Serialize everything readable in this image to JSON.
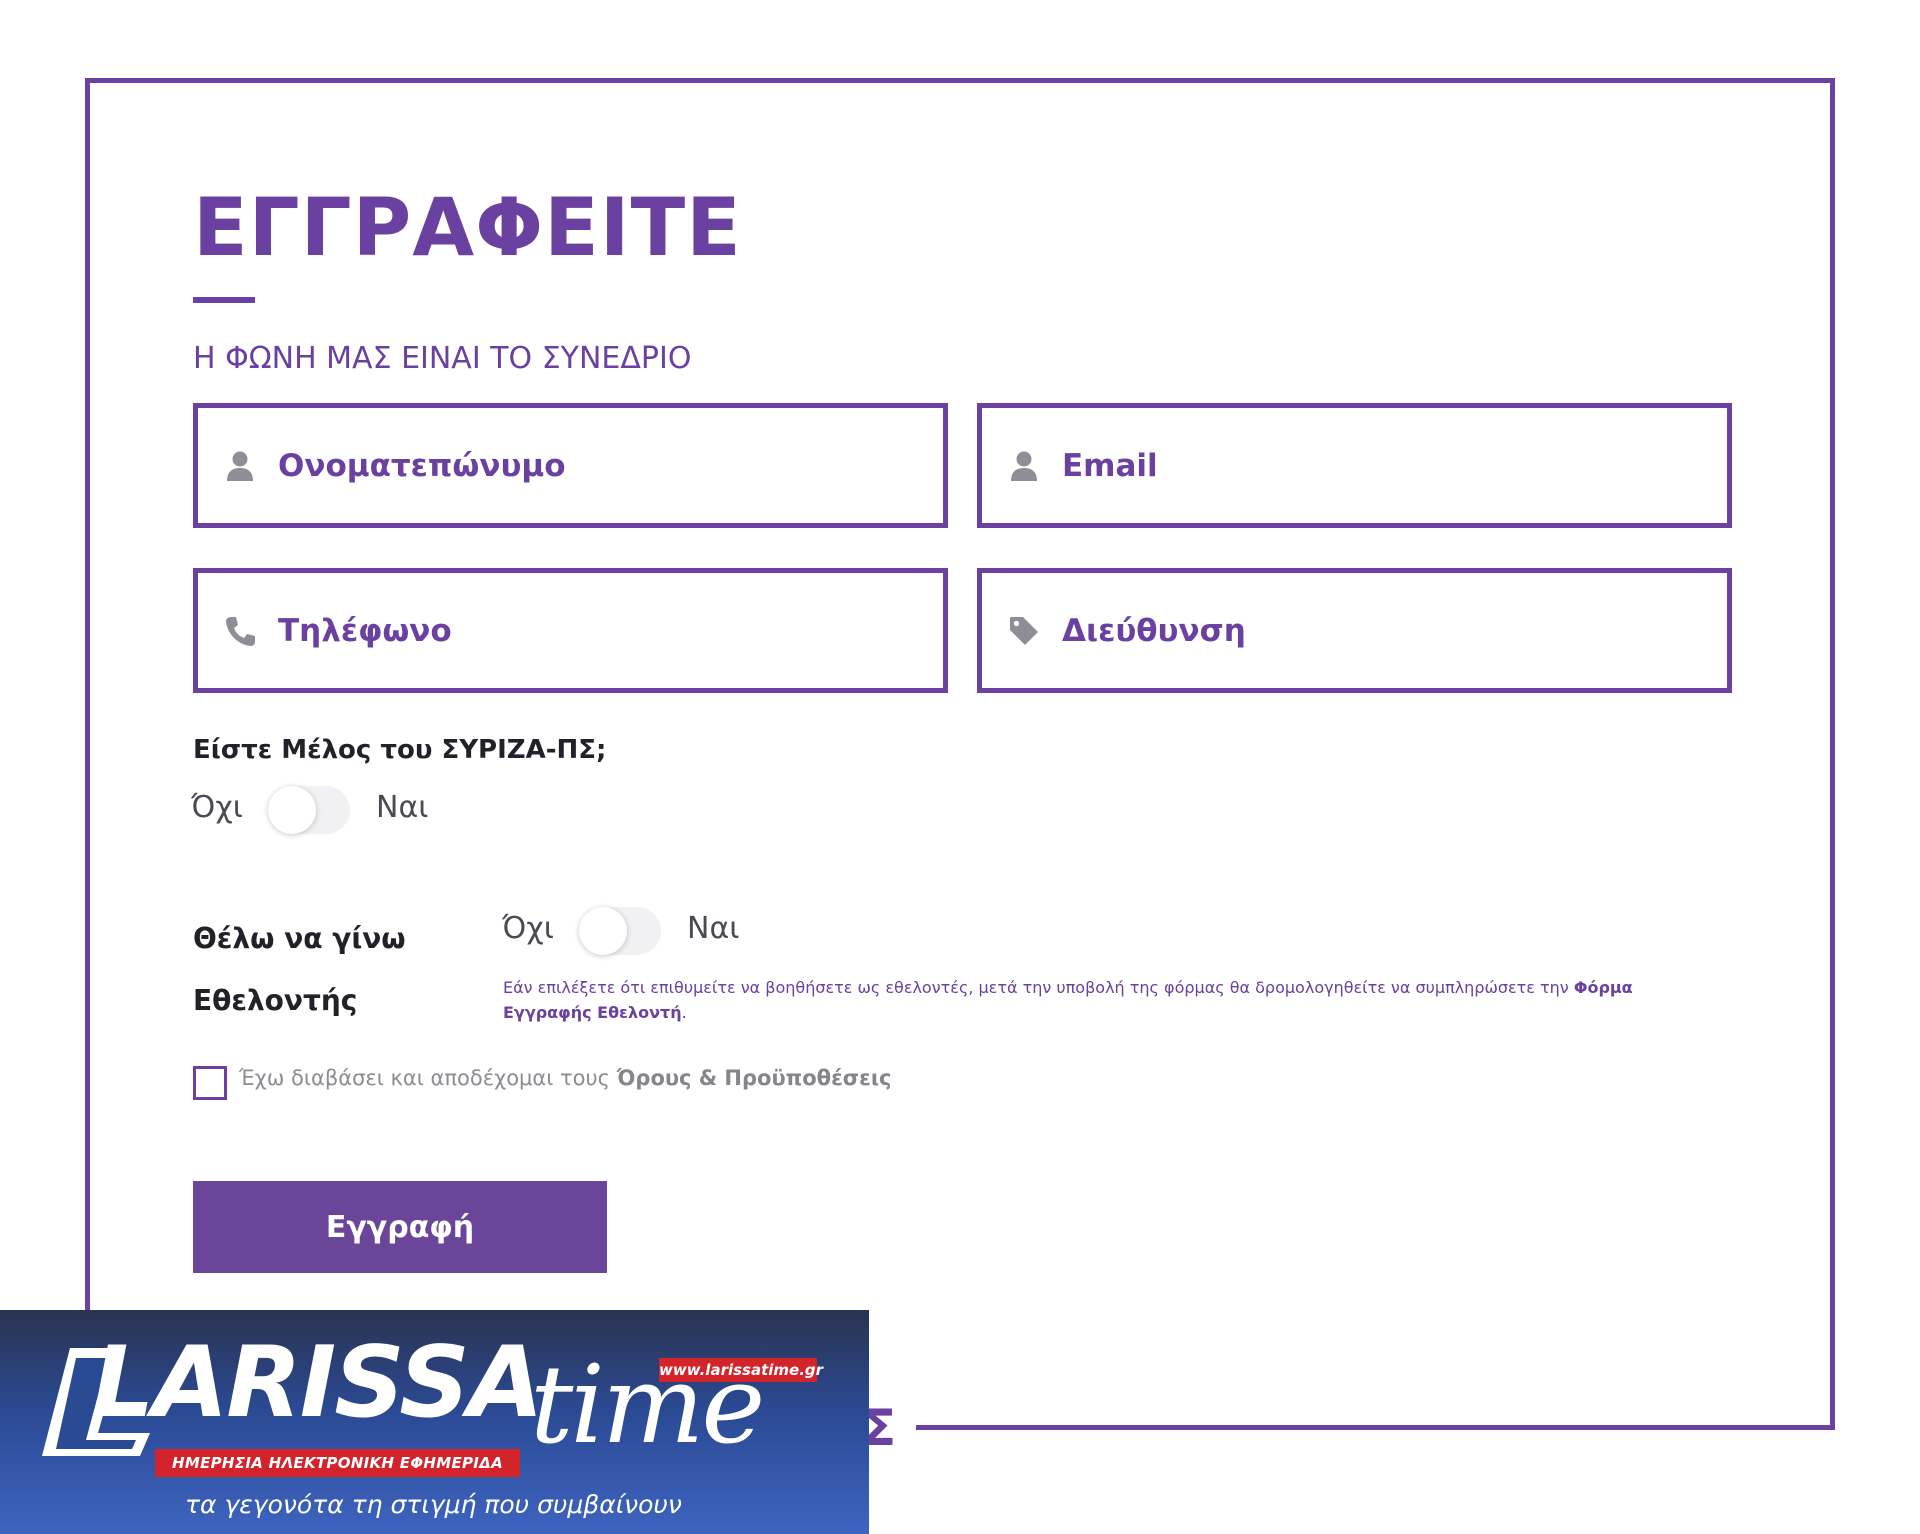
{
  "form": {
    "title": "ΕΓΓΡΑΦΕΙΤΕ",
    "subtitle": "Η ΦΩΝΗ ΜΑΣ ΕΙΝΑΙ ΤΟ ΣΥΝΕΔΡΙΟ",
    "fields": {
      "name": {
        "placeholder": "Ονοματεπώνυμο",
        "icon": "user-icon"
      },
      "email": {
        "placeholder": "Email",
        "icon": "user-icon"
      },
      "phone": {
        "placeholder": "Τηλέφωνο",
        "icon": "phone-icon"
      },
      "address": {
        "placeholder": "Διεύθυνση",
        "icon": "tag-icon"
      }
    },
    "member_question": "Είστε Μέλος του ΣΥΡΙΖΑ-ΠΣ;",
    "member_toggle": {
      "off_label": "Όχι",
      "on_label": "Ναι",
      "value": false
    },
    "volunteer_question_line1": "Θέλω να γίνω",
    "volunteer_question_line2": "Εθελοντής",
    "volunteer_toggle": {
      "off_label": "Όχι",
      "on_label": "Ναι",
      "value": false
    },
    "volunteer_note": "Εάν επιλέξετε ότι επιθυμείτε να βοηθήσετε ως εθελοντές, μετά την υποβολή της φόρμας θα δρομολογηθείτε να συμπληρώσετε την",
    "volunteer_note_link": "Φόρμα Εγγραφής Εθελοντή",
    "volunteer_note_end": ".",
    "terms_text": "Έχω διαβάσει και αποδέχομαι τους",
    "terms_link": "Όρους & Προϋποθέσεις",
    "terms_checked": false,
    "submit_label": "Εγγραφή",
    "frame_glyph": "Σ"
  },
  "banner": {
    "brand_word": "LARISSA",
    "brand_word2": "time",
    "url": "www.larissatime.gr",
    "badge": "ΗΜΕΡΗΣΙΑ ΗΛΕΚΤΡΟΝΙΚΗ ΕΦΗΜΕΡΙΔΑ",
    "tagline": "τα γεγονότα τη στιγμή που συμβαίνουν"
  },
  "colors": {
    "accent": "#6a40a0",
    "button": "#6a459a",
    "banner_red": "#d3232b",
    "banner_blue": "#2b4a94"
  }
}
